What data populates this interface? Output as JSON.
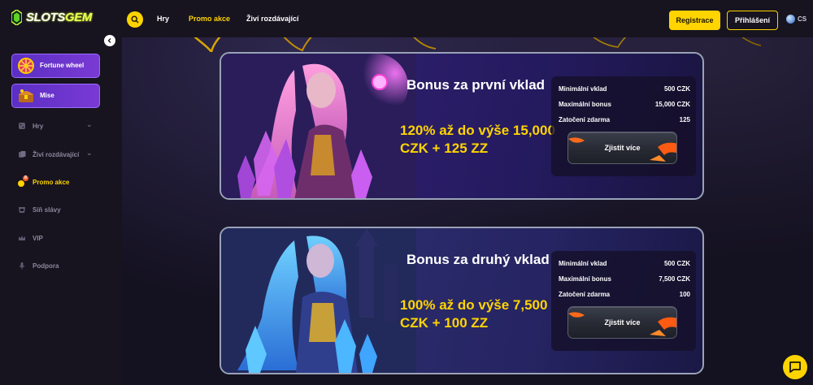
{
  "header": {
    "logo": {
      "text_main": "SLOTS",
      "text_accent": "GEM"
    },
    "nav": [
      {
        "label": "Hry",
        "active": false
      },
      {
        "label": "Promo akce",
        "active": true
      },
      {
        "label": "Živí rozdávající",
        "active": false
      }
    ],
    "register_label": "Registrace",
    "login_label": "Přihlášení",
    "language": "CS"
  },
  "sidebar": {
    "cards": [
      {
        "label": "Fortune wheel",
        "icon": "fortune-wheel-icon"
      },
      {
        "label": "Mise",
        "icon": "treasure-chest-icon"
      }
    ],
    "items": [
      {
        "label": "Hry",
        "icon": "dice-icon",
        "has_chevron": true,
        "active": false
      },
      {
        "label": "Živí rozdávající",
        "icon": "cards-icon",
        "has_chevron": true,
        "active": false
      },
      {
        "label": "Promo akce",
        "icon": "promo-icon",
        "has_chevron": false,
        "active": true,
        "badge": "8"
      },
      {
        "label": "Síň slávy",
        "icon": "hall-of-fame-icon",
        "has_chevron": false,
        "active": false
      },
      {
        "label": "VIP",
        "icon": "crown-icon",
        "has_chevron": false,
        "active": false
      },
      {
        "label": "Podpora",
        "icon": "microphone-icon",
        "has_chevron": false,
        "active": false
      }
    ]
  },
  "promos": [
    {
      "title": "Bonus za první vklad",
      "offer": "120% až do výše 15,000 CZK + 125 ZZ",
      "rows": [
        {
          "label": "Minimální vklad",
          "value": "500 CZK"
        },
        {
          "label": "Maximální bonus",
          "value": "15,000 CZK"
        },
        {
          "label": "Zatočení zdarma",
          "value": "125"
        }
      ],
      "button_label": "Zjistit více"
    },
    {
      "title": "Bonus za druhý vklad",
      "offer": "100% až do výše 7,500 CZK + 100 ZZ",
      "rows": [
        {
          "label": "Minimální vklad",
          "value": "500 CZK"
        },
        {
          "label": "Maximální bonus",
          "value": "7,500 CZK"
        },
        {
          "label": "Zatočení zdarma",
          "value": "100"
        }
      ],
      "button_label": "Zjistit více"
    }
  ],
  "colors": {
    "accent": "#ffd400",
    "background": "#15121f",
    "sidebar_card": "#6a35cc",
    "card_border": "#9aa2b6"
  }
}
